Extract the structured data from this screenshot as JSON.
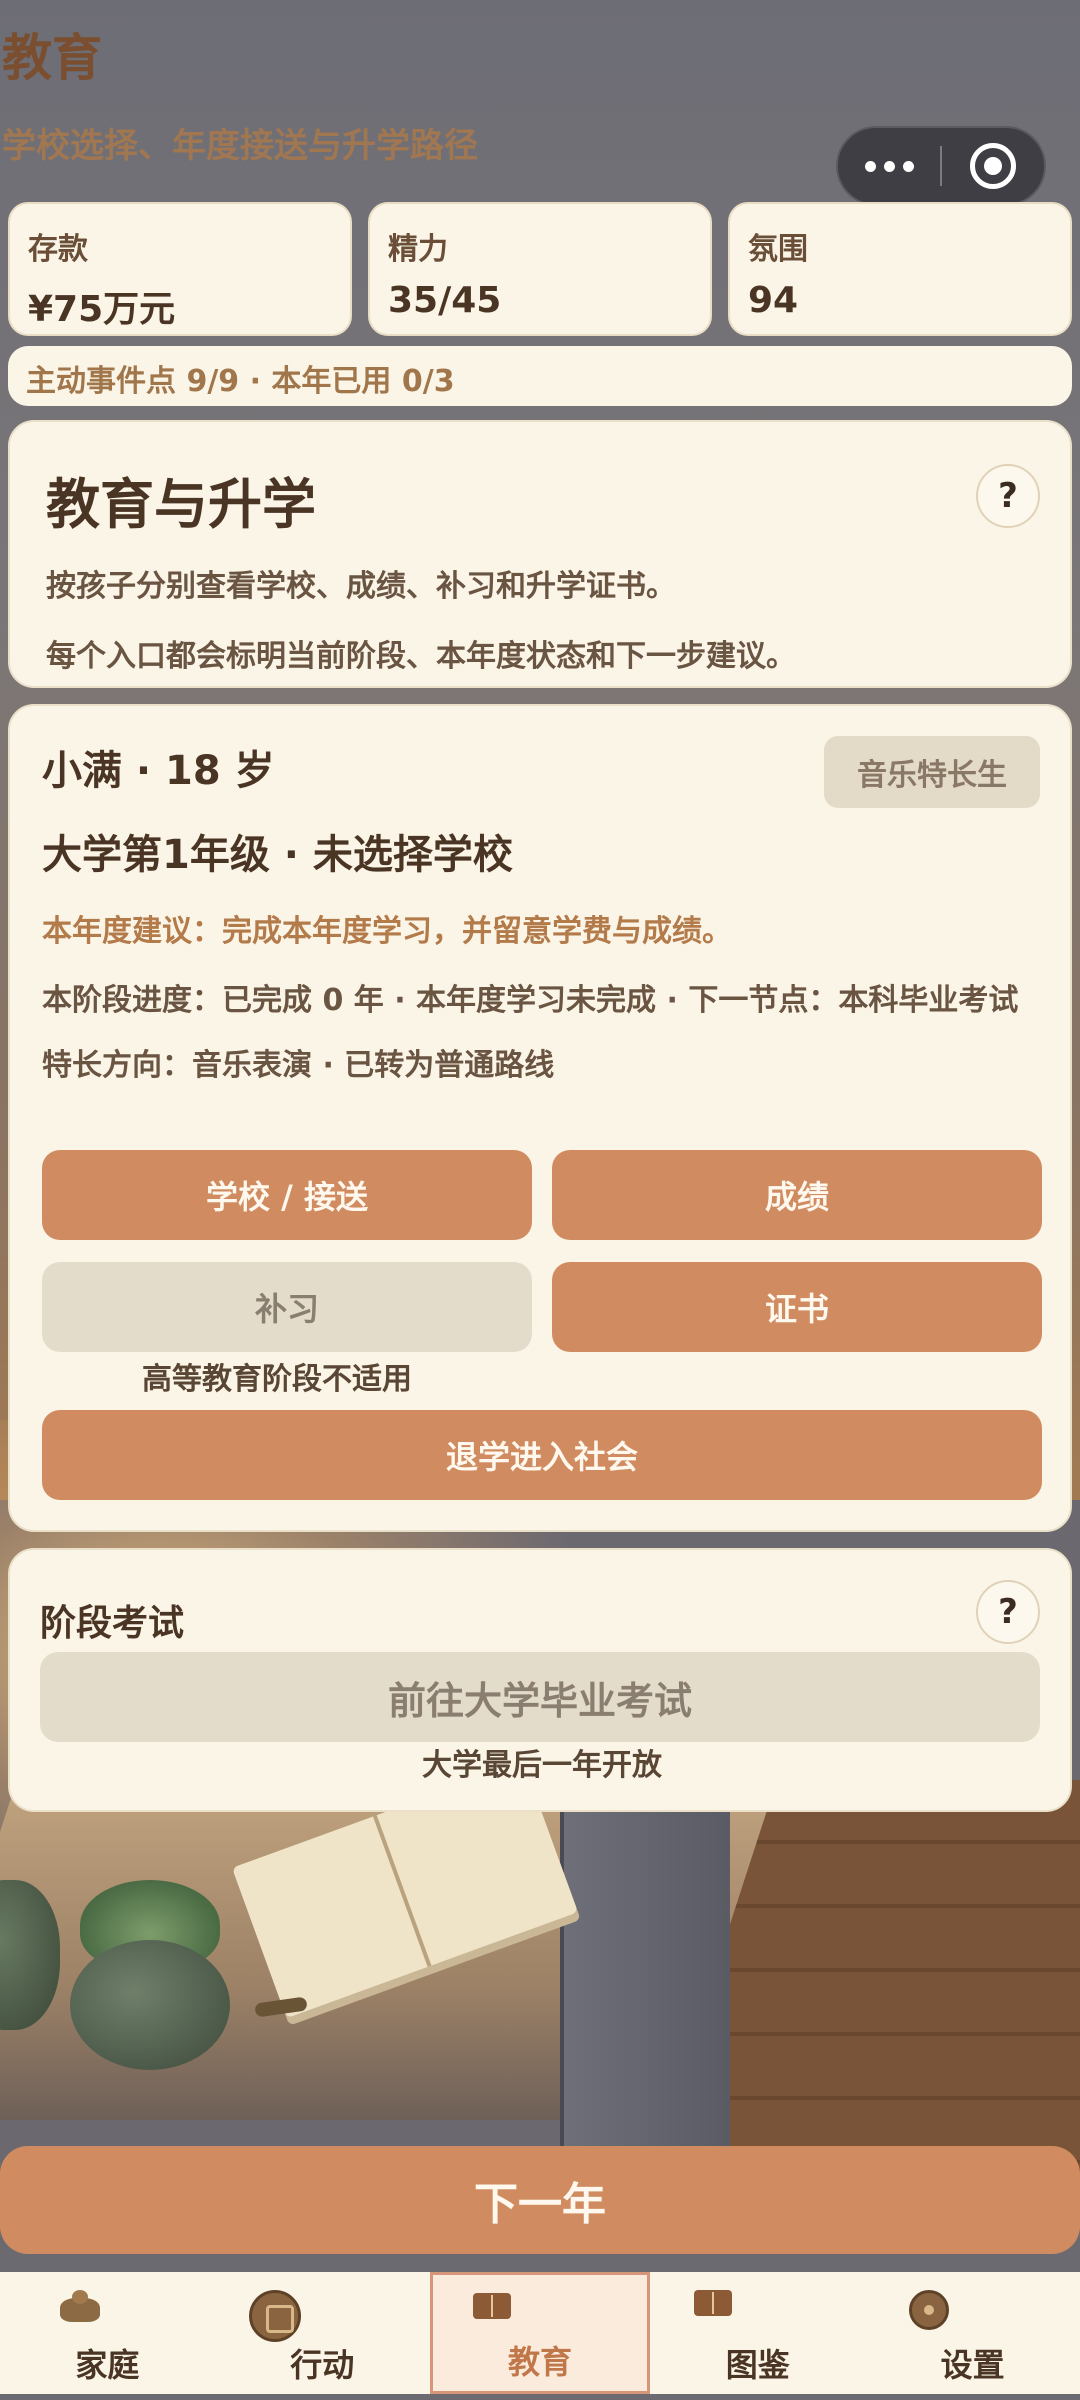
{
  "header": {
    "title": "教育",
    "subtitle": "学校选择、年度接送与升学路径"
  },
  "stats": [
    {
      "label": "存款",
      "value": "¥75万元"
    },
    {
      "label": "精力",
      "value": "35/45"
    },
    {
      "label": "氛围",
      "value": "94"
    }
  ],
  "events_bar": "主动事件点 9/9 · 本年已用 0/3",
  "intro": {
    "title": "教育与升学",
    "desc1": "按孩子分别查看学校、成绩、补习和升学证书。",
    "desc2": "每个入口都会标明当前阶段、本年度状态和下一步建议。",
    "help": "?"
  },
  "child": {
    "name_age": "小满 · 18 岁",
    "grade": "大学第1年级 · 未选择学校",
    "tag": "音乐特长生",
    "suggestion": "本年度建议：完成本年度学习，并留意学费与成绩。",
    "progress": "本阶段进度：已完成 0 年 · 本年度学习未完成 · 下一节点：本科毕业考试",
    "talent": "特长方向：音乐表演 · 已转为普通路线",
    "buttons": {
      "school": "学校 / 接送",
      "grades": "成绩",
      "tutoring": "补习",
      "certificate": "证书",
      "dropout": "退学进入社会"
    },
    "tutoring_note": "高等教育阶段不适用"
  },
  "exam": {
    "title": "阶段考试",
    "help": "?",
    "button": "前往大学毕业考试",
    "note": "大学最后一年开放"
  },
  "next_year": "下一年",
  "tabs": [
    {
      "label": "家庭",
      "icon": "home-icon",
      "active": false
    },
    {
      "label": "行动",
      "icon": "action-icon",
      "active": false
    },
    {
      "label": "教育",
      "icon": "education-book-icon",
      "active": true
    },
    {
      "label": "图鉴",
      "icon": "catalog-book-icon",
      "active": false
    },
    {
      "label": "设置",
      "icon": "settings-icon",
      "active": false
    }
  ],
  "colors": {
    "accent": "#d08c60",
    "card": "#fbf5e8",
    "disabled": "#e4dccb",
    "text": "#4a3524",
    "suggestion": "#b37a4a"
  }
}
